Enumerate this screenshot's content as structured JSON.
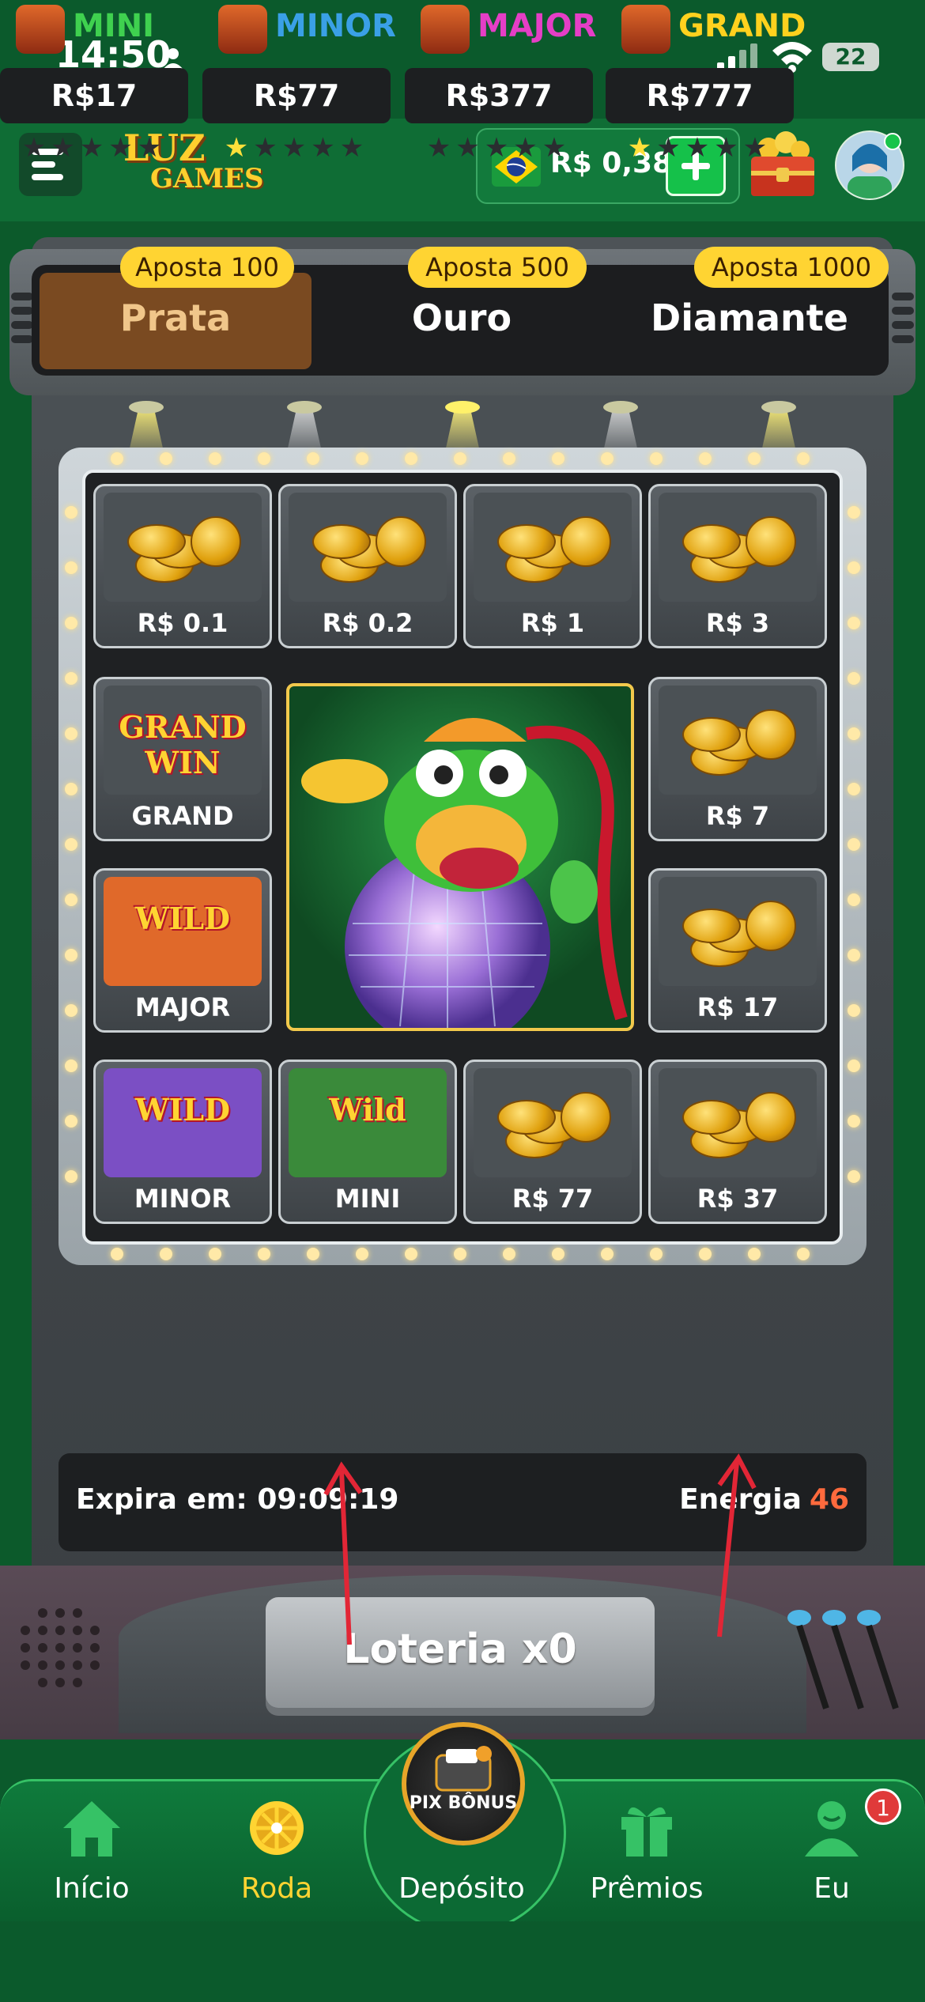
{
  "status_bar": {
    "time": "14:50",
    "battery": "22"
  },
  "header": {
    "logo_line1": "LUZ",
    "logo_line2": "GAMES",
    "balance": "R$ 0,38"
  },
  "bet_tabs": [
    {
      "badge": "Aposta 100",
      "label": "Prata",
      "active": true
    },
    {
      "badge": "Aposta 500",
      "label": "Ouro",
      "active": false
    },
    {
      "badge": "Aposta 1000",
      "label": "Diamante",
      "active": false
    }
  ],
  "board": {
    "tiles": [
      {
        "label": "R$ 0.1",
        "icon": "coins-icon"
      },
      {
        "label": "R$ 0.2",
        "icon": "coins-icon"
      },
      {
        "label": "R$ 1",
        "icon": "coins-icon"
      },
      {
        "label": "R$ 3",
        "icon": "coins-icon"
      },
      {
        "label": "GRAND",
        "icon": "grand-win-icon",
        "art_text": "GRAND WIN"
      },
      {
        "label": "R$ 7",
        "icon": "coins-icon"
      },
      {
        "label": "MAJOR",
        "icon": "tiger-wild-icon",
        "art_text": "WILD"
      },
      {
        "label": "R$ 17",
        "icon": "coins-icon"
      },
      {
        "label": "MINOR",
        "icon": "rabbit-wild-icon",
        "art_text": "WILD"
      },
      {
        "label": "MINI",
        "icon": "dragon-wild-icon",
        "art_text": "Wild"
      },
      {
        "label": "R$ 77",
        "icon": "coins-icon"
      },
      {
        "label": "R$ 37",
        "icon": "coins-icon"
      }
    ],
    "center_image": "dragon-disco-ball-icon"
  },
  "jackpots": [
    {
      "name": "MINI",
      "value": "R$17",
      "stars_filled": 0,
      "stars_total": 5,
      "color": "#3fd14f"
    },
    {
      "name": "MINOR",
      "value": "R$77",
      "stars_filled": 1,
      "stars_total": 5,
      "color": "#3aa0e6"
    },
    {
      "name": "MAJOR",
      "value": "R$377",
      "stars_filled": 0,
      "stars_total": 5,
      "color": "#e53ec6"
    },
    {
      "name": "GRAND",
      "value": "R$777",
      "stars_filled": 1,
      "stars_total": 5,
      "color": "#ffd11e"
    }
  ],
  "info": {
    "expira_label": "Expira em: 09:09:19",
    "energia_label": "Energia",
    "energia_value": "46"
  },
  "play_button": "Loteria x0",
  "nav": [
    {
      "label": "Início",
      "icon": "home-icon",
      "active": false
    },
    {
      "label": "Roda",
      "icon": "wheel-icon",
      "active": true
    },
    {
      "label": "Depósito",
      "icon": "pix-bonus-icon",
      "active": false,
      "art_text": "PIX BÔNUS"
    },
    {
      "label": "Prêmios",
      "icon": "gift-icon",
      "active": false
    },
    {
      "label": "Eu",
      "icon": "user-icon",
      "active": false,
      "badge": "1"
    }
  ],
  "colors": {
    "brand_green": "#0f6d35",
    "accent_yellow": "#ffd432",
    "active_tab": "#7a4a21",
    "energia": "#ff6a3d"
  }
}
